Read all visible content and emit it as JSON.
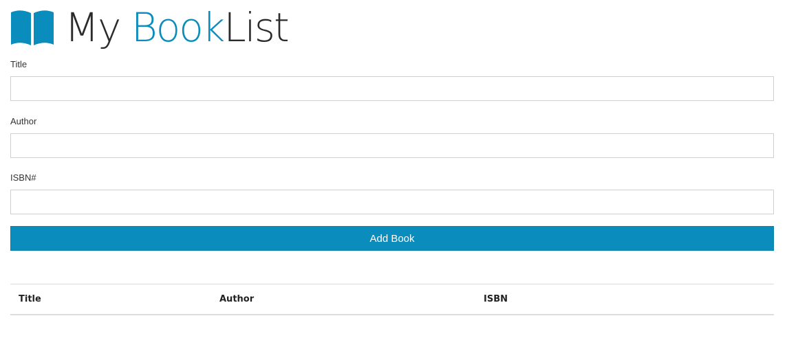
{
  "theme": {
    "accent_color": "#0a8cbd",
    "text_color": "#2b2b2b"
  },
  "header": {
    "icon": "open-book-icon",
    "title_part1": "My ",
    "title_part2": "Book",
    "title_part3": "List"
  },
  "form": {
    "title_label": "Title",
    "title_value": "",
    "author_label": "Author",
    "author_value": "",
    "isbn_label": "ISBN#",
    "isbn_value": "",
    "submit_label": "Add Book"
  },
  "table": {
    "columns": [
      "Title",
      "Author",
      "ISBN"
    ],
    "rows": []
  }
}
